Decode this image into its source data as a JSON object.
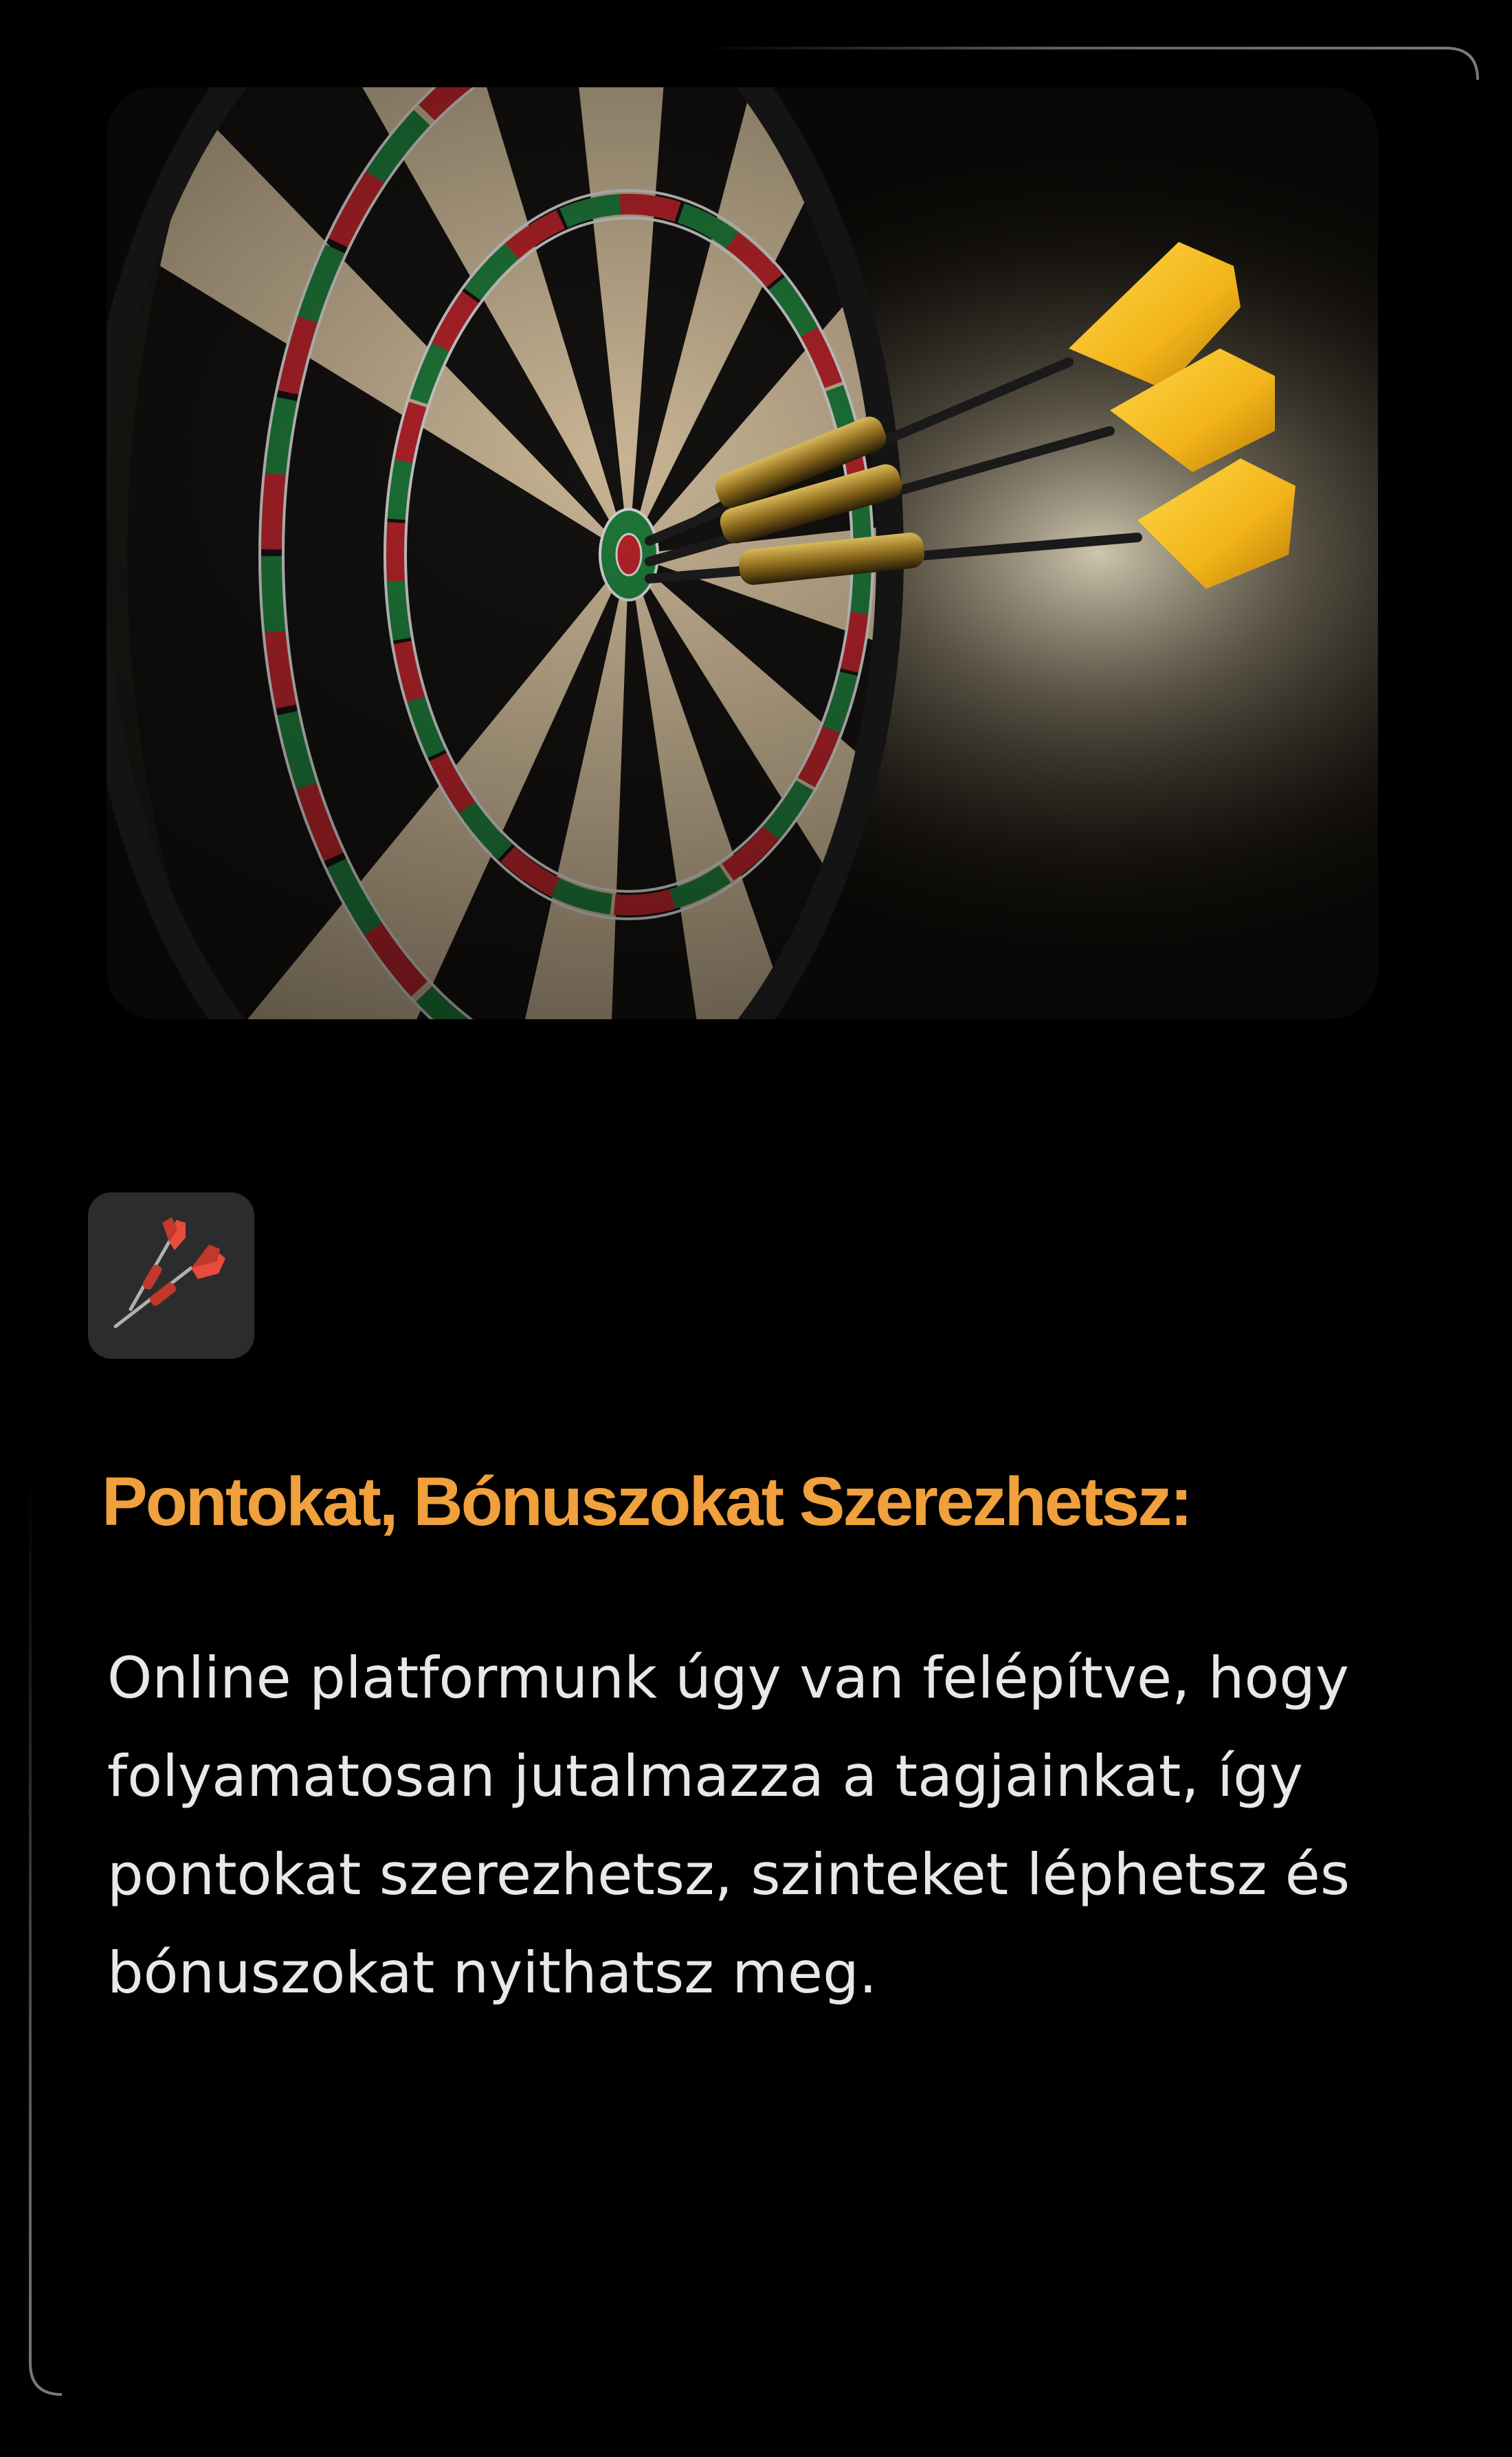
{
  "colors": {
    "background": "#000000",
    "accent_heading": "#f0a03c",
    "body_text": "#e8e8e8",
    "icon_tile": "#2c2c2e",
    "card_border": "#5a5a5a"
  },
  "hero_image": {
    "icon": "dartboard-with-darts-image"
  },
  "feature_icon": {
    "icon": "darts-icon"
  },
  "feature": {
    "heading": "Pontokat, Bónuszokat Szerezhetsz:",
    "description": "Online platformunk úgy van felépítve, hogy folyamatosan jutalmazza a tagjainkat, így pontokat szerezhetsz, szinteket léphetsz és bónuszokat nyithatsz meg."
  }
}
